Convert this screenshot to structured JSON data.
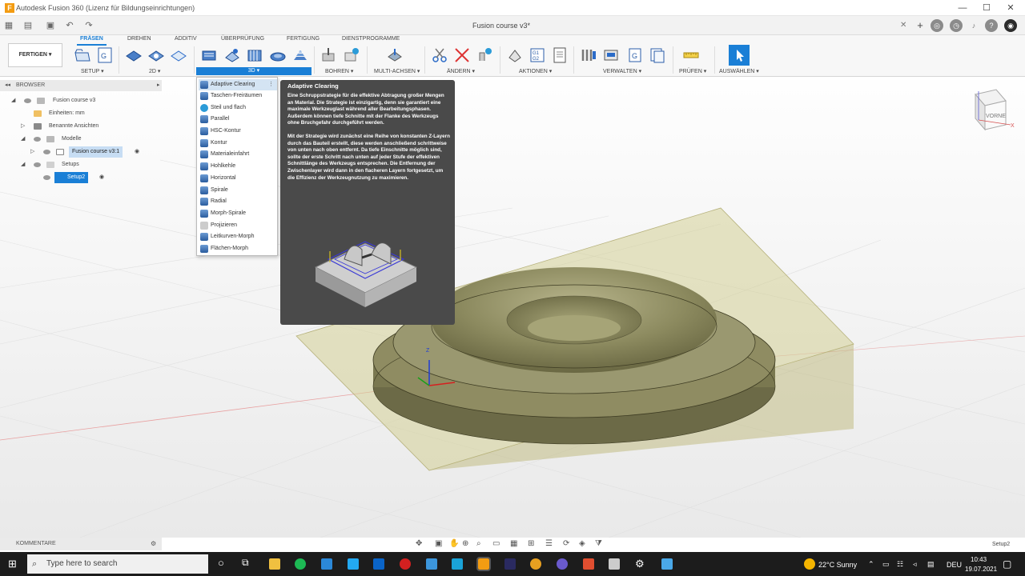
{
  "window": {
    "title": "Autodesk Fusion 360 (Lizenz für Bildungseinrichtungen)",
    "doc_title": "Fusion course v3*"
  },
  "ribbon": {
    "workspace": "FERTIGEN ▾",
    "tabs": [
      "FRÄSEN",
      "DREHEN",
      "ADDITIV",
      "ÜBERPRÜFUNG",
      "FERTIGUNG",
      "DIENSTPROGRAMME"
    ],
    "groups": [
      "SETUP ▾",
      "2D ▾",
      "3D ▾",
      "BOHREN ▾",
      "MULTI-ACHSEN ▾",
      "ÄNDERN ▾",
      "AKTIONEN ▾",
      "VERWALTEN ▾",
      "PRÜFEN ▾",
      "AUSWÄHLEN ▾"
    ]
  },
  "browser": {
    "header": "BROWSER",
    "root": "Fusion course v3",
    "units": "Einheiten: mm",
    "named_views": "Benannte Ansichten",
    "models": "Modelle",
    "model_item": "Fusion course v3:1",
    "setups": "Setups",
    "setup_item": "Setup2"
  },
  "menu_3d": {
    "items": [
      "Adaptive Clearing",
      "Taschen-Freiräumen",
      "Steil und flach",
      "Parallel",
      "HSC-Kontur",
      "Kontur",
      "Materialeinfahrt",
      "Hohlkehle",
      "Horizontal",
      "Spirale",
      "Radial",
      "Morph-Spirale",
      "Projizieren",
      "Leitkurven-Morph",
      "Flächen-Morph"
    ]
  },
  "tooltip": {
    "title": "Adaptive Clearing",
    "p1": "Eine Schruppstrategie für die effektive Abtragung großer Mengen an Material. Die Strategie ist einzigartig, denn sie garantiert eine maximale Werkzeuglast während aller Bearbeitungsphasen. Außerdem können tiefe Schnitte mit der Flanke des Werkzeugs ohne Bruchgefahr durchgeführt werden.",
    "p2": "Mit der Strategie wird zunächst eine Reihe von konstanten Z-Layern durch das Bauteil erstellt, diese werden anschließend schrittweise von unten nach oben entfernt. Da tiefe Einschnitte möglich sind, sollte der erste Schritt nach unten auf jeder Stufe der effektiven Schnittlänge des Werkzeugs entsprechen. Die Entfernung der Zwischenlayer wird dann in den flacheren Layern fortgesetzt, um die Effizienz der Werkzeugnutzung zu maximieren."
  },
  "viewcube": {
    "face": "VORNE",
    "axis_x": "X",
    "axis_z": "Z"
  },
  "bottom": {
    "comments": "KOMMENTARE",
    "status": "Setup2"
  },
  "taskbar": {
    "search_placeholder": "Type here to search",
    "weather": "22°C  Sunny",
    "lang": "DEU",
    "time": "10:43",
    "date": "19.07.2021"
  }
}
